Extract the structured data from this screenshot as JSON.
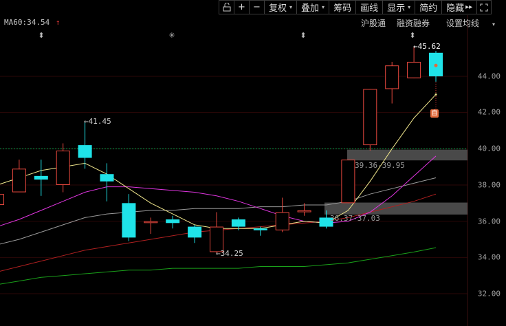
{
  "toolbar": {
    "items": [
      {
        "label": "",
        "icon": "unlock-icon"
      },
      {
        "label": "+",
        "icon": "zoom-in-icon"
      },
      {
        "label": "−",
        "icon": "zoom-out-icon"
      },
      {
        "label": "复权",
        "caret": true
      },
      {
        "label": "叠加",
        "caret": true
      },
      {
        "label": "筹码"
      },
      {
        "label": "画线"
      },
      {
        "label": "显示",
        "caret": true
      },
      {
        "label": "简约"
      },
      {
        "label": "隐藏",
        "extra": "▸▸"
      },
      {
        "label": "",
        "icon": "fullscreen-icon"
      }
    ]
  },
  "indicator": {
    "name": "MA60:",
    "value": "34.54",
    "arrow": "↑"
  },
  "sublinks": {
    "hgt": "沪股通",
    "margin": "融资融券",
    "ma_settings": "设置均线"
  },
  "markers": [
    "⬍",
    "✳",
    "⬍",
    "⬍"
  ],
  "annotations": {
    "high_peak": "45.62",
    "mid_high": "41.45",
    "low": "34.25",
    "range_upper": "39.36-39.95",
    "range_lower": "36.37-37.03",
    "self_badge": "自"
  },
  "y_axis": {
    "ticks": [
      "44.00",
      "42.00",
      "40.00",
      "38.00",
      "36.00",
      "34.00",
      "32.00"
    ]
  },
  "colors": {
    "up": "#e8483e",
    "down": "#1fe3e8",
    "ma5": "#f0e68c",
    "ma10": "#e035e0",
    "ma20": "#9a9a9a",
    "ma30": "#b02020",
    "ma60": "#1aa01a",
    "grid": "#2a0000",
    "dotted": "#00aa55"
  },
  "chart_data": {
    "type": "candlestick",
    "ylim": [
      31.4,
      46.6
    ],
    "candles": [
      {
        "o": 36.9,
        "h": 37.6,
        "l": 36.3,
        "c": 37.5
      },
      {
        "o": 37.6,
        "h": 39.4,
        "l": 37.6,
        "c": 38.9
      },
      {
        "o": 38.5,
        "h": 39.4,
        "l": 37.4,
        "c": 38.3
      },
      {
        "o": 38.0,
        "h": 40.3,
        "l": 37.6,
        "c": 39.9
      },
      {
        "o": 40.2,
        "h": 41.45,
        "l": 38.9,
        "c": 39.5
      },
      {
        "o": 38.6,
        "h": 39.2,
        "l": 37.1,
        "c": 38.2
      },
      {
        "o": 37.0,
        "h": 37.5,
        "l": 34.9,
        "c": 35.1
      },
      {
        "o": 35.9,
        "h": 36.2,
        "l": 35.3,
        "c": 36.0
      },
      {
        "o": 36.1,
        "h": 36.3,
        "l": 35.6,
        "c": 35.9
      },
      {
        "o": 35.7,
        "h": 35.8,
        "l": 34.8,
        "c": 35.1
      },
      {
        "o": 34.3,
        "h": 36.5,
        "l": 34.25,
        "c": 35.7
      },
      {
        "o": 36.1,
        "h": 36.2,
        "l": 35.5,
        "c": 35.7
      },
      {
        "o": 35.6,
        "h": 35.7,
        "l": 35.2,
        "c": 35.5
      },
      {
        "o": 35.5,
        "h": 37.3,
        "l": 35.4,
        "c": 36.5
      },
      {
        "o": 36.5,
        "h": 37.0,
        "l": 36.3,
        "c": 36.6
      },
      {
        "o": 36.2,
        "h": 36.6,
        "l": 35.6,
        "c": 35.7
      },
      {
        "o": 37.0,
        "h": 39.4,
        "l": 37.0,
        "c": 39.4
      },
      {
        "o": 40.2,
        "h": 43.3,
        "l": 39.9,
        "c": 43.3
      },
      {
        "o": 43.3,
        "h": 44.8,
        "l": 42.5,
        "c": 44.6
      },
      {
        "o": 43.9,
        "h": 45.62,
        "l": 43.9,
        "c": 44.8
      },
      {
        "o": 45.3,
        "h": 45.4,
        "l": 43.7,
        "c": 44.0
      }
    ],
    "ma5": [
      38.0,
      38.4,
      38.8,
      39.0,
      39.2,
      38.6,
      37.8,
      37.0,
      36.4,
      35.8,
      35.6,
      35.6,
      35.6,
      35.8,
      36.0,
      35.9,
      36.6,
      38.2,
      40.0,
      41.7,
      43.0
    ],
    "ma10": [
      35.7,
      36.1,
      36.6,
      37.1,
      37.6,
      37.9,
      37.9,
      37.8,
      37.7,
      37.6,
      37.4,
      37.1,
      36.7,
      36.3,
      36.0,
      35.9,
      36.0,
      36.5,
      37.4,
      38.5,
      39.6
    ],
    "ma20": [
      34.7,
      35.0,
      35.4,
      35.8,
      36.2,
      36.4,
      36.5,
      36.6,
      36.6,
      36.7,
      36.7,
      36.7,
      36.8,
      36.8,
      36.9,
      36.9,
      37.1,
      37.5,
      37.8,
      38.1,
      38.4
    ],
    "ma30": [
      33.2,
      33.5,
      33.8,
      34.1,
      34.4,
      34.6,
      34.8,
      35.0,
      35.2,
      35.4,
      35.5,
      35.6,
      35.7,
      35.8,
      35.9,
      36.0,
      36.2,
      36.5,
      36.8,
      37.1,
      37.5
    ],
    "ma60": [
      32.5,
      32.7,
      32.9,
      33.0,
      33.1,
      33.2,
      33.3,
      33.3,
      33.4,
      33.4,
      33.4,
      33.4,
      33.5,
      33.5,
      33.5,
      33.6,
      33.7,
      33.9,
      34.1,
      34.3,
      34.54
    ],
    "price_bands": [
      {
        "from": 39.36,
        "to": 39.95
      },
      {
        "from": 36.37,
        "to": 37.03
      }
    ],
    "dotted_level": 40.0
  }
}
